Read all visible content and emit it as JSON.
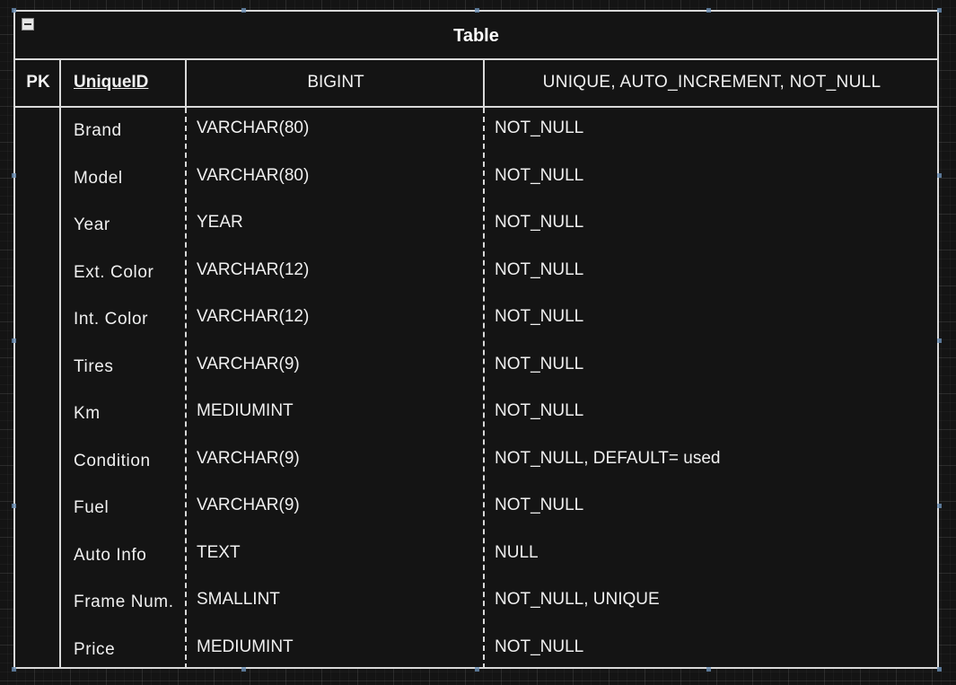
{
  "table": {
    "title": "Table",
    "header": {
      "pk": "PK",
      "name": "UniqueID",
      "type": "BIGINT",
      "constraints": "UNIQUE, AUTO_INCREMENT, NOT_NULL"
    },
    "rows": [
      {
        "name": "Brand",
        "type": "VARCHAR(80)",
        "constraints": "NOT_NULL"
      },
      {
        "name": "Model",
        "type": "VARCHAR(80)",
        "constraints": "NOT_NULL"
      },
      {
        "name": "Year",
        "type": "YEAR",
        "constraints": "NOT_NULL"
      },
      {
        "name": "Ext. Color",
        "type": "VARCHAR(12)",
        "constraints": "NOT_NULL"
      },
      {
        "name": "Int. Color",
        "type": "VARCHAR(12)",
        "constraints": "NOT_NULL"
      },
      {
        "name": "Tires",
        "type": "VARCHAR(9)",
        "constraints": "NOT_NULL"
      },
      {
        "name": "Km",
        "type": "MEDIUMINT",
        "constraints": "NOT_NULL"
      },
      {
        "name": "Condition",
        "type": "VARCHAR(9)",
        "constraints": "NOT_NULL, DEFAULT= used"
      },
      {
        "name": "Fuel",
        "type": "VARCHAR(9)",
        "constraints": "NOT_NULL"
      },
      {
        "name": "Auto Info",
        "type": "TEXT",
        "constraints": "NULL"
      },
      {
        "name": "Frame Num.",
        "type": "SMALLINT",
        "constraints": "NOT_NULL, UNIQUE"
      },
      {
        "name": "Price",
        "type": "MEDIUMINT",
        "constraints": "NOT_NULL"
      }
    ]
  },
  "icons": {
    "collapse": "collapse-minus-icon"
  },
  "colors": {
    "background": "#141414",
    "border": "#d9d9d9",
    "text": "#f0f0f0",
    "selection_handle": "#6a8fb5"
  }
}
